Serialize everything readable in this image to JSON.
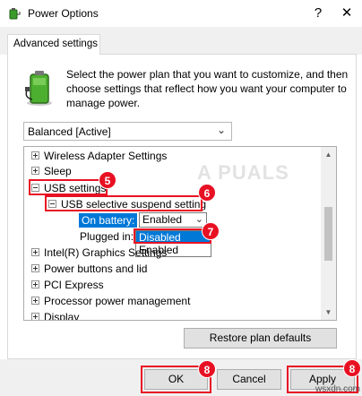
{
  "window": {
    "title": "Power Options",
    "close_glyph": "✕",
    "help_glyph": "?"
  },
  "tabs": [
    {
      "label": "Advanced settings"
    }
  ],
  "description": "Select the power plan that you want to customize, and then choose settings that reflect how you want your computer to manage power.",
  "plan_select": {
    "value": "Balanced [Active]"
  },
  "tree": {
    "items": [
      {
        "label": "Wireless Adapter Settings"
      },
      {
        "label": "Sleep"
      },
      {
        "label": "USB settings"
      },
      {
        "label": "USB selective suspend setting"
      },
      {
        "label": "On battery:",
        "value": "Enabled"
      },
      {
        "label": "Plugged in:"
      },
      {
        "label": "Intel(R) Graphics Settings"
      },
      {
        "label": "Power buttons and lid"
      },
      {
        "label": "PCI Express"
      },
      {
        "label": "Processor power management"
      },
      {
        "label": "Display"
      }
    ],
    "dropdown_options": [
      "Disabled",
      "Enabled"
    ]
  },
  "buttons": {
    "restore": "Restore plan defaults",
    "ok": "OK",
    "cancel": "Cancel",
    "apply": "Apply"
  },
  "badges": {
    "b5": "5",
    "b6": "6",
    "b7": "7",
    "b8a": "8",
    "b8b": "8"
  },
  "watermark": "A PUALS",
  "site_mark": "wsxdn.com",
  "colors": {
    "highlight": "#0078d7",
    "annotation": "#e81123"
  }
}
